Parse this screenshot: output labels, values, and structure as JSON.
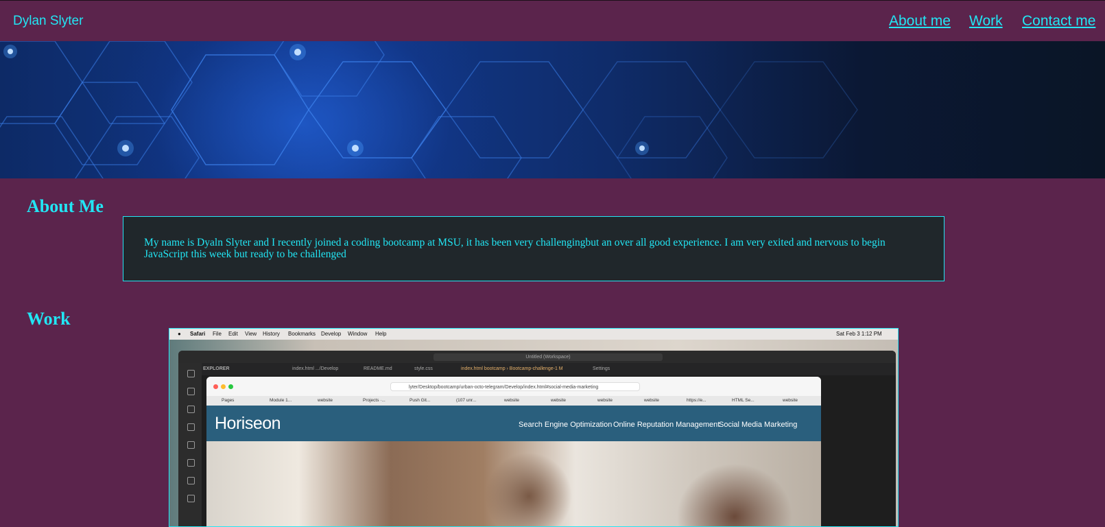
{
  "header": {
    "site_name": "Dylan Slyter",
    "nav": [
      "About me",
      "Work",
      "Contact me"
    ]
  },
  "about": {
    "heading": "About Me",
    "text": "My name is Dyaln Slyter and I recently joined a coding bootcamp at MSU, it has been very challengingbut an over all good experience. I am very exited and nervous to begin JavaScript this week but ready to be challenged"
  },
  "work": {
    "heading": "Work",
    "screenshot": {
      "menubar": [
        "Safari",
        "File",
        "Edit",
        "View",
        "History",
        "Bookmarks",
        "Develop",
        "Window",
        "Help"
      ],
      "clock": "Sat Feb 3  1:12 PM",
      "vscode_search": "Untitled (Workspace)",
      "vscode_tabs": [
        "EXPLORER",
        "index.html .../Develop",
        "README.md",
        "style.css",
        "index.html bootcamp › Bootcamp-challenge-1 M",
        "Settings"
      ],
      "url": "lyter/Desktop/bootcamp/urban-octo-telegram/Develop/index.html#social-media-marketing",
      "bookmarks": [
        "Pages",
        "Module 1...",
        "website",
        "Projects ·...",
        "Push Git...",
        "(107 unr...",
        "website",
        "website",
        "website",
        "website",
        "https://e...",
        "HTML Se...",
        "website"
      ],
      "site_logo": "Horiseon",
      "site_nav": [
        "Search Engine Optimization",
        "Online Reputation Management",
        "Social Media Marketing"
      ]
    }
  },
  "colors": {
    "background": "#5b244c",
    "accent": "#22e6f4",
    "box": "#20272b"
  }
}
